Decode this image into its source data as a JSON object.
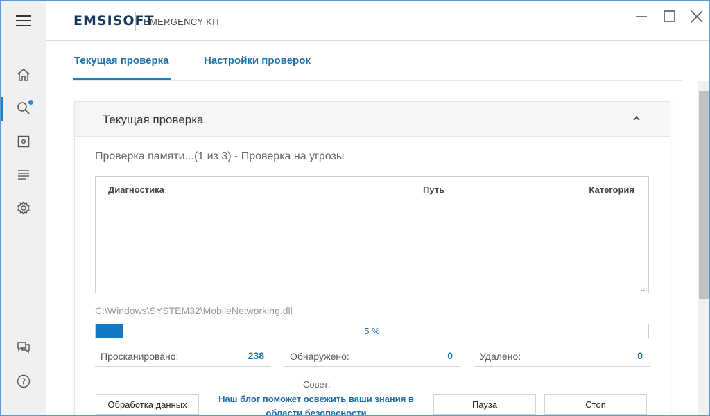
{
  "app": {
    "logo": "EMSISOFT",
    "product": "EMERGENCY KIT"
  },
  "window_controls": [
    "minimize-icon",
    "maximize-icon",
    "close-icon"
  ],
  "sidebar": {
    "items": [
      {
        "name": "home",
        "icon": "home-icon"
      },
      {
        "name": "scan",
        "icon": "search-icon",
        "active": true,
        "badge": true
      },
      {
        "name": "quarantine",
        "icon": "quarantine-icon"
      },
      {
        "name": "logs",
        "icon": "logs-icon"
      },
      {
        "name": "settings",
        "icon": "gear-icon"
      },
      {
        "name": "feedback",
        "icon": "chat-icon"
      },
      {
        "name": "help",
        "icon": "help-icon"
      }
    ]
  },
  "tabs": [
    {
      "label": "Текущая проверка",
      "active": true
    },
    {
      "label": "Настройки проверок",
      "active": false
    }
  ],
  "panel": {
    "title": "Текущая проверка",
    "status": "Проверка памяти...(1 из 3) - Проверка на угрозы",
    "columns": {
      "diagnosis": "Диагностика",
      "path": "Путь",
      "category": "Категория"
    },
    "current_file": "C:\\Windows\\SYSTEM32\\MobileNetworking.dll",
    "progress": {
      "percent": 5,
      "label": "5 %"
    },
    "stats": {
      "scanned_label": "Просканировано:",
      "scanned_value": "238",
      "detected_label": "Обнаружено:",
      "detected_value": "0",
      "removed_label": "Удалено:",
      "removed_value": "0"
    },
    "tip": {
      "label": "Совет:",
      "link": "Наш блог поможет освежить ваши знания в области безопасности"
    },
    "buttons": {
      "data_processing": "Обработка данных",
      "pause": "Пауза",
      "stop": "Стоп"
    }
  },
  "colors": {
    "accent": "#1a7fc4",
    "link": "#1a6fa8",
    "sidebar_bg": "#eef0f2"
  }
}
